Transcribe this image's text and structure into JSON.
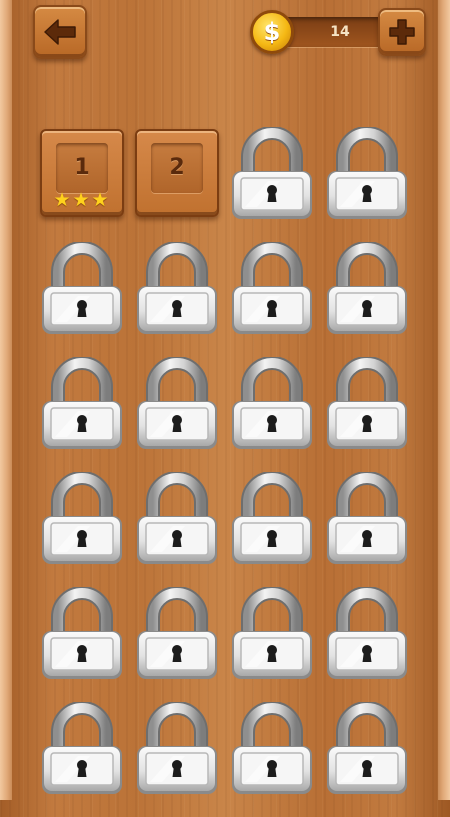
{
  "header": {
    "back_icon": "arrow-left-icon",
    "coin_symbol": "$",
    "coins": "14",
    "add_icon": "plus-icon"
  },
  "levels": [
    {
      "number": "1",
      "state": "unlocked",
      "stars": 3,
      "stars_text": "★★★"
    },
    {
      "number": "2",
      "state": "unlocked",
      "stars": 0,
      "stars_text": ""
    },
    {
      "state": "locked"
    },
    {
      "state": "locked"
    },
    {
      "state": "locked"
    },
    {
      "state": "locked"
    },
    {
      "state": "locked"
    },
    {
      "state": "locked"
    },
    {
      "state": "locked"
    },
    {
      "state": "locked"
    },
    {
      "state": "locked"
    },
    {
      "state": "locked"
    },
    {
      "state": "locked"
    },
    {
      "state": "locked"
    },
    {
      "state": "locked"
    },
    {
      "state": "locked"
    },
    {
      "state": "locked"
    },
    {
      "state": "locked"
    },
    {
      "state": "locked"
    },
    {
      "state": "locked"
    },
    {
      "state": "locked"
    },
    {
      "state": "locked"
    },
    {
      "state": "locked"
    },
    {
      "state": "locked"
    }
  ],
  "colors": {
    "wood": "#c27a3f",
    "coin": "#f5b814",
    "lock": "#e6e6e6"
  }
}
